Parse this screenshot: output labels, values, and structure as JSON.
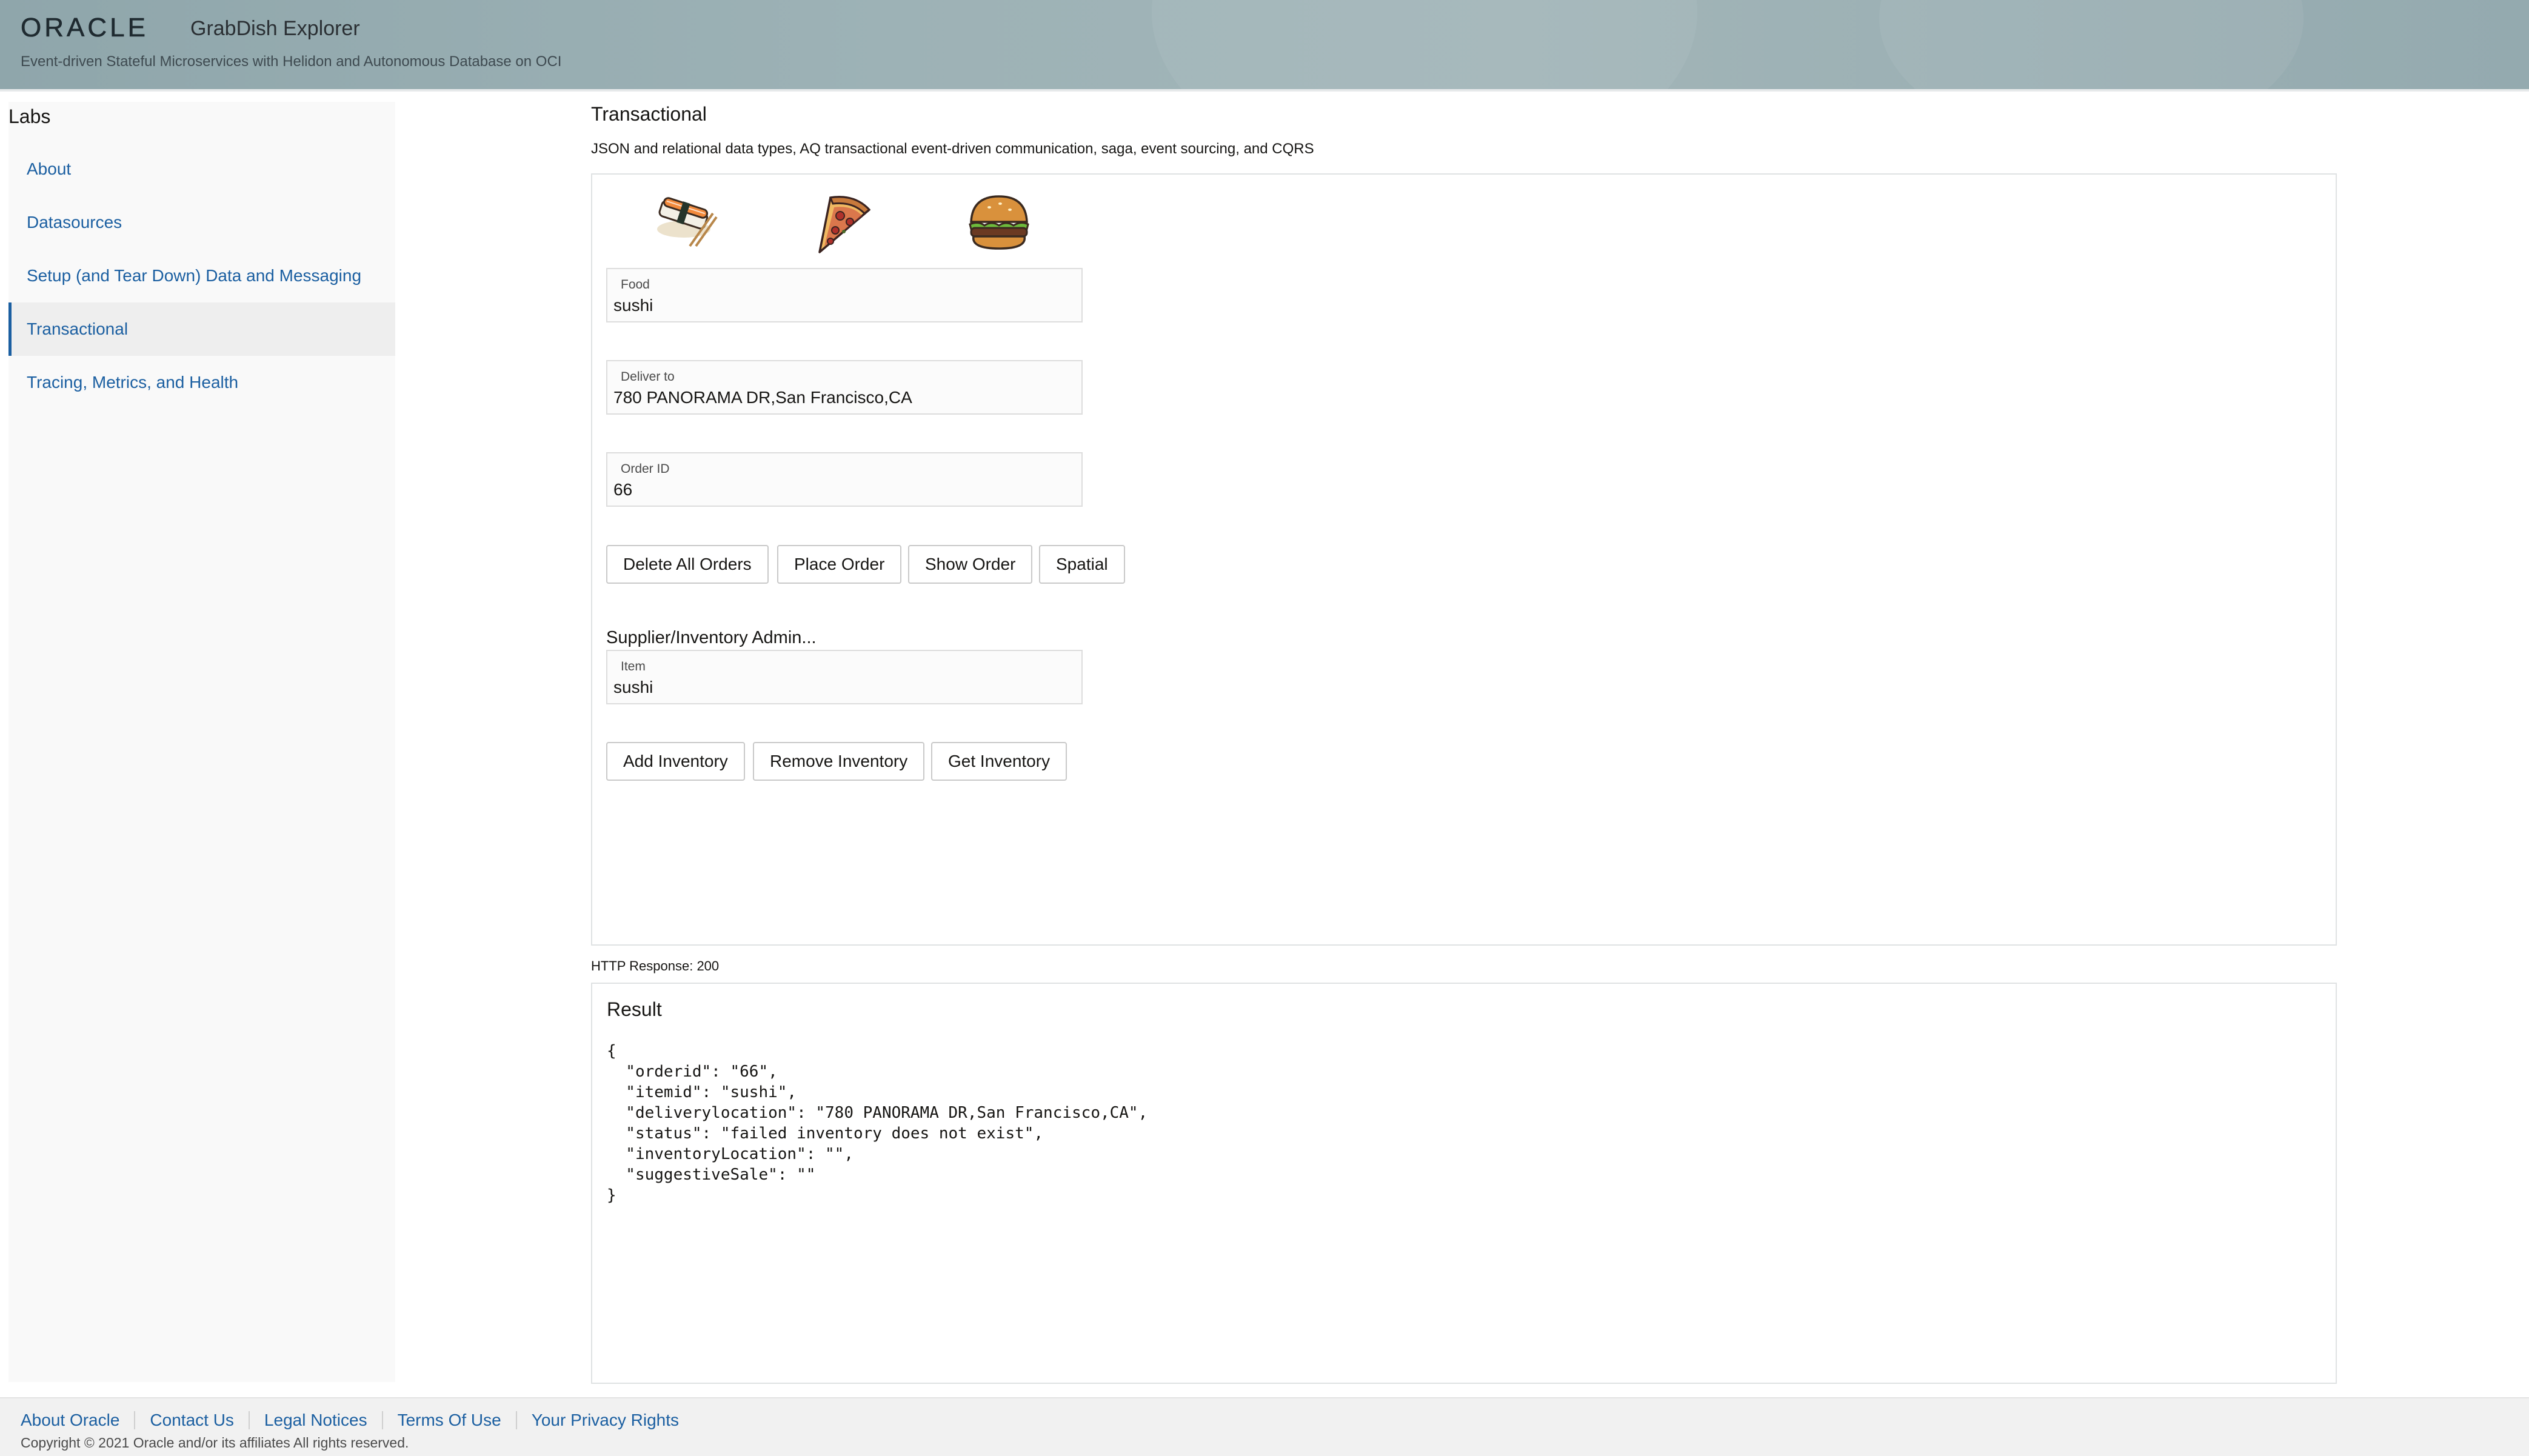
{
  "header": {
    "logo_text": "ORACLE",
    "app_title": "GrabDish Explorer",
    "subtitle": "Event-driven Stateful Microservices with Helidon and Autonomous Database on OCI"
  },
  "sidebar": {
    "heading": "Labs",
    "items": [
      {
        "label": "About",
        "active": false
      },
      {
        "label": "Datasources",
        "active": false
      },
      {
        "label": "Setup (and Tear Down) Data and Messaging",
        "active": false
      },
      {
        "label": "Transactional",
        "active": true
      },
      {
        "label": "Tracing, Metrics, and Health",
        "active": false
      }
    ]
  },
  "main": {
    "title": "Transactional",
    "description": "JSON and relational data types, AQ transactional event-driven communication, saga, event sourcing, and CQRS",
    "food_icons": [
      "sushi-icon",
      "pizza-icon",
      "burger-icon"
    ],
    "fields": {
      "food": {
        "label": "Food",
        "value": "sushi"
      },
      "deliver_to": {
        "label": "Deliver to",
        "value": "780 PANORAMA DR,San Francisco,CA"
      },
      "order_id": {
        "label": "Order ID",
        "value": "66"
      }
    },
    "order_buttons": {
      "delete_all": "Delete All Orders",
      "place": "Place Order",
      "show": "Show Order",
      "spatial": "Spatial"
    },
    "supplier": {
      "heading": "Supplier/Inventory Admin...",
      "item_label": "Item",
      "item_value": "sushi",
      "buttons": {
        "add": "Add Inventory",
        "remove": "Remove Inventory",
        "get": "Get Inventory"
      }
    },
    "http_status": "HTTP Response: 200",
    "result": {
      "title": "Result",
      "body": "{\n  \"orderid\": \"66\",\n  \"itemid\": \"sushi\",\n  \"deliverylocation\": \"780 PANORAMA DR,San Francisco,CA\",\n  \"status\": \"failed inventory does not exist\",\n  \"inventoryLocation\": \"\",\n  \"suggestiveSale\": \"\"\n}"
    }
  },
  "footer": {
    "links": [
      "About Oracle",
      "Contact Us",
      "Legal Notices",
      "Terms Of Use",
      "Your Privacy Rights"
    ],
    "copyright": "Copyright © 2021 Oracle and/or its affiliates All rights reserved."
  },
  "colors": {
    "link": "#1b5fa1",
    "header_bg": "#9db2b6",
    "sidebar_bg": "#f9f9f9",
    "active_item_bg": "#eeeeee"
  }
}
